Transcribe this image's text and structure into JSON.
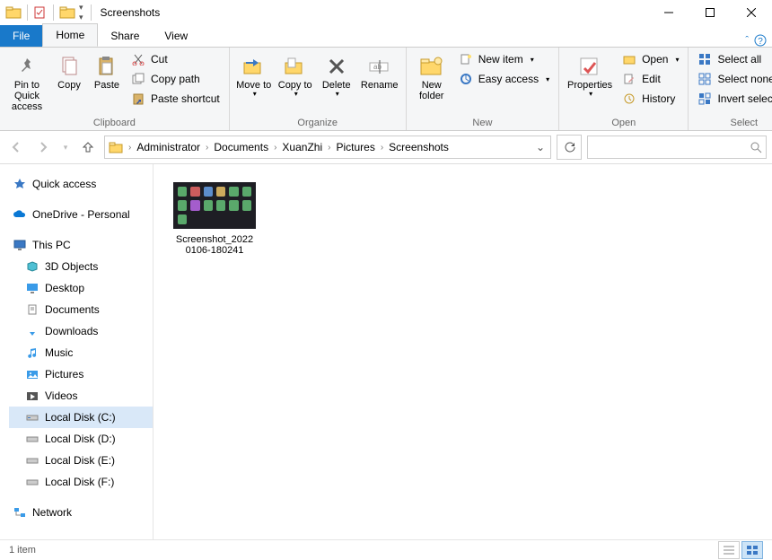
{
  "window_title": "Screenshots",
  "tabs": {
    "file": "File",
    "home": "Home",
    "share": "Share",
    "view": "View"
  },
  "ribbon": {
    "clipboard": {
      "label": "Clipboard",
      "pin": "Pin to Quick access",
      "copy": "Copy",
      "paste": "Paste",
      "cut": "Cut",
      "copy_path": "Copy path",
      "paste_shortcut": "Paste shortcut"
    },
    "organize": {
      "label": "Organize",
      "move_to": "Move to",
      "copy_to": "Copy to",
      "delete": "Delete",
      "rename": "Rename"
    },
    "new": {
      "label": "New",
      "new_folder": "New folder",
      "new_item": "New item",
      "easy_access": "Easy access"
    },
    "open": {
      "label": "Open",
      "properties": "Properties",
      "open": "Open",
      "edit": "Edit",
      "history": "History"
    },
    "select": {
      "label": "Select",
      "select_all": "Select all",
      "select_none": "Select none",
      "invert": "Invert selection"
    }
  },
  "breadcrumb": [
    "Administrator",
    "Documents",
    "XuanZhi",
    "Pictures",
    "Screenshots"
  ],
  "nav": {
    "quick_access": "Quick access",
    "onedrive": "OneDrive - Personal",
    "this_pc": "This PC",
    "objects3d": "3D Objects",
    "desktop": "Desktop",
    "documents": "Documents",
    "downloads": "Downloads",
    "music": "Music",
    "pictures": "Pictures",
    "videos": "Videos",
    "disk_c": "Local Disk (C:)",
    "disk_d": "Local Disk (D:)",
    "disk_e": "Local Disk (E:)",
    "disk_f": "Local Disk (F:)",
    "network": "Network"
  },
  "file_item": {
    "name_l1": "Screenshot_2022",
    "name_l2": "0106-180241"
  },
  "status_text": "1 item"
}
